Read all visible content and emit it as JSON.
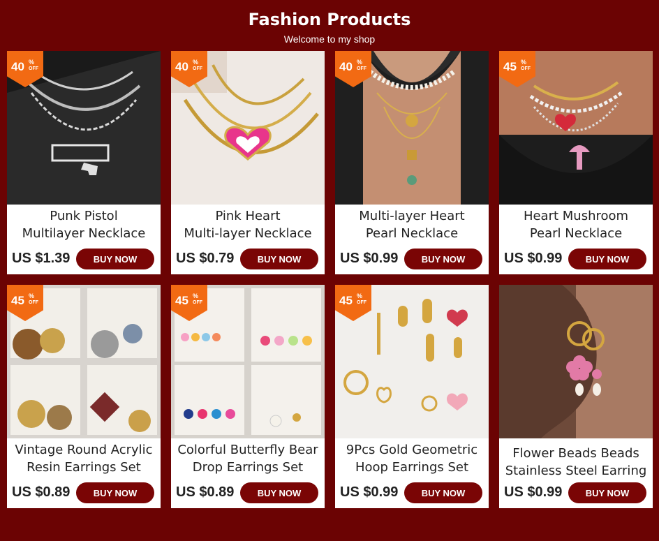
{
  "header": {
    "title": "Fashion Products",
    "subtitle": "Welcome to my shop"
  },
  "colors": {
    "background": "#6b0303",
    "button": "#7a0505",
    "badge": "#f26a13"
  },
  "products": [
    {
      "name_line1": "Punk Pistol",
      "name_line2": "Multilayer Necklace",
      "price": "US $1.39",
      "discount": "40",
      "discount_pct": "%",
      "discount_off": "OFF",
      "button": "BUY NOW",
      "image": "necklace-photo"
    },
    {
      "name_line1": "Pink Heart",
      "name_line2": "Multi-layer Necklace",
      "price": "US $0.79",
      "discount": "40",
      "discount_pct": "%",
      "discount_off": "OFF",
      "button": "BUY NOW",
      "image": "necklace-photo"
    },
    {
      "name_line1": "Multi-layer Heart",
      "name_line2": "Pearl Necklace",
      "price": "US $0.99",
      "discount": "40",
      "discount_pct": "%",
      "discount_off": "OFF",
      "button": "BUY NOW",
      "image": "necklace-photo"
    },
    {
      "name_line1": "Heart Mushroom",
      "name_line2": "Pearl Necklace",
      "price": "US $0.99",
      "discount": "45",
      "discount_pct": "%",
      "discount_off": "OFF",
      "button": "BUY NOW",
      "image": "necklace-photo"
    },
    {
      "name_line1": "Vintage Round Acrylic",
      "name_line2": "Resin Earrings Set",
      "price": "US $0.89",
      "discount": "45",
      "discount_pct": "%",
      "discount_off": "OFF",
      "button": "BUY NOW",
      "image": "earrings-photo"
    },
    {
      "name_line1": "Colorful Butterfly Bear",
      "name_line2": "Drop Earrings Set",
      "price": "US $0.89",
      "discount": "45",
      "discount_pct": "%",
      "discount_off": "OFF",
      "button": "BUY NOW",
      "image": "earrings-photo"
    },
    {
      "name_line1": "9Pcs Gold Geometric",
      "name_line2": "Hoop Earrings Set",
      "price": "US $0.99",
      "discount": "45",
      "discount_pct": "%",
      "discount_off": "OFF",
      "button": "BUY NOW",
      "image": "earrings-photo"
    },
    {
      "name_line1": "Flower Beads Beads",
      "name_line2": "Stainless Steel Earring",
      "price": "US $0.99",
      "discount": "",
      "discount_pct": "",
      "discount_off": "",
      "button": "BUY NOW",
      "image": "earrings-photo"
    }
  ]
}
